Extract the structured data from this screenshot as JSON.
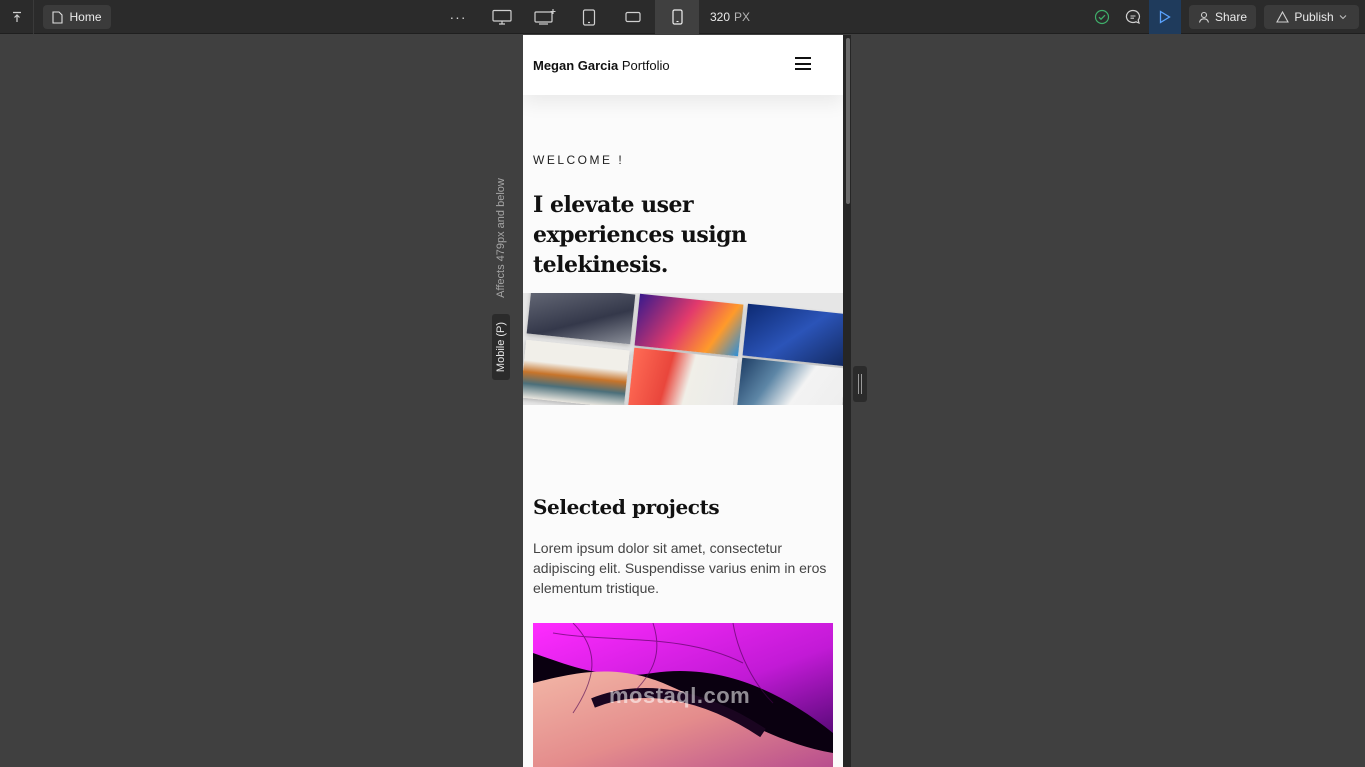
{
  "toolbar": {
    "home_label": "Home",
    "more_label": "···",
    "width_value": "320",
    "width_unit": "PX",
    "share_label": "Share",
    "publish_label": "Publish",
    "active_breakpoint": "mobile-portrait"
  },
  "breakpoint": {
    "affects_label": "Affects 479px and below",
    "mobile_label": "Mobile (P)"
  },
  "site": {
    "brand_bold": "Megan Garcia",
    "brand_rest": "Portfolio",
    "welcome": "WELCOME !",
    "headline": "I elevate user experiences usign telekinesis.",
    "projects_title": "Selected projects",
    "projects_text": "Lorem ipsum dolor sit amet, consectetur adipiscing elit. Suspendisse varius enim in eros elementum tristique.",
    "watermark": "mostaql.com"
  },
  "colors": {
    "toolbar_bg": "#2b2b2b",
    "canvas_bg": "#404040",
    "preview_accent": "#1f3b5c",
    "status_ok": "#3fae6a"
  },
  "icons": [
    "exit-icon",
    "page-icon",
    "desktop-icon",
    "desktop-star-icon",
    "tablet-icon",
    "mobile-landscape-icon",
    "mobile-portrait-icon",
    "check-icon",
    "comment-icon",
    "play-icon",
    "user-icon",
    "publish-icon",
    "chevron-down-icon",
    "hamburger-icon"
  ]
}
